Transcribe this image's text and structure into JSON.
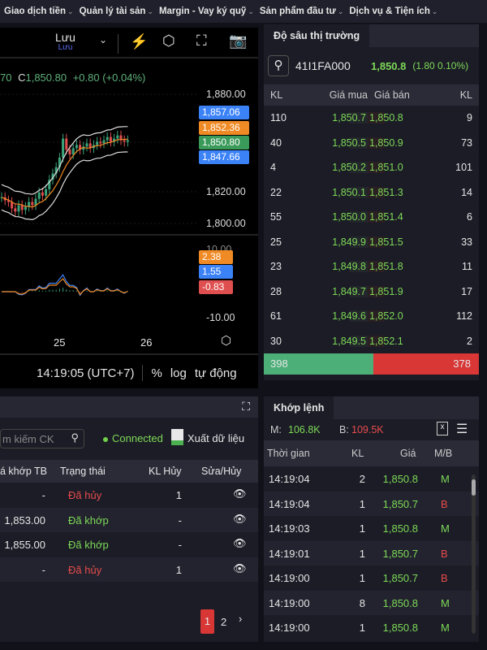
{
  "nav": [
    "Giao dịch tiền",
    "Quản lý tài sản",
    "Margin - Vay ký quỹ",
    "Sản phẩm đầu tư",
    "Dịch vụ & Tiện ích"
  ],
  "chart": {
    "layout_label": "Lưu",
    "layout_sub": "Lưu",
    "ohlc_prefix": "70",
    "close_label": "C",
    "close": "1,850.80",
    "change": "+0.80 (+0.04%)",
    "price_axis": [
      "1,880.00",
      "1,820.00",
      "1,800.00"
    ],
    "price_tags": [
      {
        "v": "1,857.06",
        "color": "#3b82f6"
      },
      {
        "v": "1,852.36",
        "color": "#f08a24"
      },
      {
        "v": "1,850.80",
        "color": "#3a9a5a"
      },
      {
        "v": "1,847.66",
        "color": "#3b82f6"
      }
    ],
    "ind_axis": [
      "-10.00"
    ],
    "ind_top": "10.00",
    "ind_tags": [
      {
        "v": "2.38",
        "color": "#f08a24"
      },
      {
        "v": "1.55",
        "color": "#3b82f6"
      },
      {
        "v": "-0.83",
        "color": "#e04f4f"
      }
    ],
    "x_labels": [
      "25",
      "26"
    ],
    "time": "14:19:05 (UTC+7)",
    "pct": "%",
    "log": "log",
    "auto": "tự động",
    "closes": [
      1815,
      1813,
      1812,
      1808,
      1806,
      1810,
      1807,
      1809,
      1812,
      1810,
      1814,
      1818,
      1816,
      1820,
      1826,
      1830,
      1834,
      1840,
      1852,
      1845,
      1842,
      1846,
      1848,
      1845,
      1847,
      1849,
      1846,
      1848,
      1850,
      1849,
      1851,
      1853,
      1850,
      1852,
      1854,
      1851,
      1850,
      1851
    ]
  },
  "depth": {
    "tab": "Độ sâu thị trường",
    "symbol": "41I1FA000",
    "price": "1,850.8",
    "change": "(1.80 0.10%)",
    "headers": [
      "KL",
      "Giá mua",
      "Giá bán",
      "KL"
    ],
    "rows": [
      [
        "110",
        "1,850.7",
        "1,850.8",
        "9"
      ],
      [
        "40",
        "1,850.5",
        "1,850.9",
        "73"
      ],
      [
        "4",
        "1,850.2",
        "1,851.0",
        "101"
      ],
      [
        "22",
        "1,850.1",
        "1,851.3",
        "14"
      ],
      [
        "55",
        "1,850.0",
        "1,851.4",
        "6"
      ],
      [
        "25",
        "1,849.9",
        "1,851.5",
        "33"
      ],
      [
        "23",
        "1,849.8",
        "1,851.8",
        "11"
      ],
      [
        "28",
        "1,849.7",
        "1,851.9",
        "17"
      ],
      [
        "61",
        "1,849.6",
        "1,852.0",
        "112"
      ],
      [
        "30",
        "1,849.5",
        "1,852.1",
        "2"
      ]
    ],
    "total_buy": "398",
    "total_sell": "378",
    "buy_ratio": 0.51
  },
  "orders": {
    "search_placeholder": "m kiếm CK",
    "status": "Connected",
    "export": "Xuất dữ liệu",
    "headers": [
      "á khớp TB",
      "Trạng thái",
      "KL Hủy",
      "Sửa/Hủy"
    ],
    "rows": [
      [
        "-",
        "Đã hủy",
        "1"
      ],
      [
        "1,853.00",
        "Đã khớp",
        "-"
      ],
      [
        "1,855.00",
        "Đã khớp",
        "-"
      ],
      [
        "-",
        "Đã hủy",
        "1"
      ]
    ],
    "pages": [
      "1",
      "2"
    ]
  },
  "trades": {
    "tab": "Khớp lệnh",
    "m_label": "M:",
    "m_val": "106.8K",
    "b_label": "B:",
    "b_val": "109.5K",
    "headers": [
      "Thời gian",
      "KL",
      "Giá",
      "M/B"
    ],
    "rows": [
      [
        "14:19:04",
        "2",
        "1,850.8",
        "M"
      ],
      [
        "14:19:04",
        "1",
        "1,850.7",
        "B"
      ],
      [
        "14:19:03",
        "1",
        "1,850.8",
        "M"
      ],
      [
        "14:19:01",
        "1",
        "1,850.7",
        "B"
      ],
      [
        "14:19:00",
        "1",
        "1,850.7",
        "B"
      ],
      [
        "14:19:00",
        "8",
        "1,850.8",
        "M"
      ],
      [
        "14:19:00",
        "1",
        "1,850.8",
        "M"
      ]
    ]
  }
}
